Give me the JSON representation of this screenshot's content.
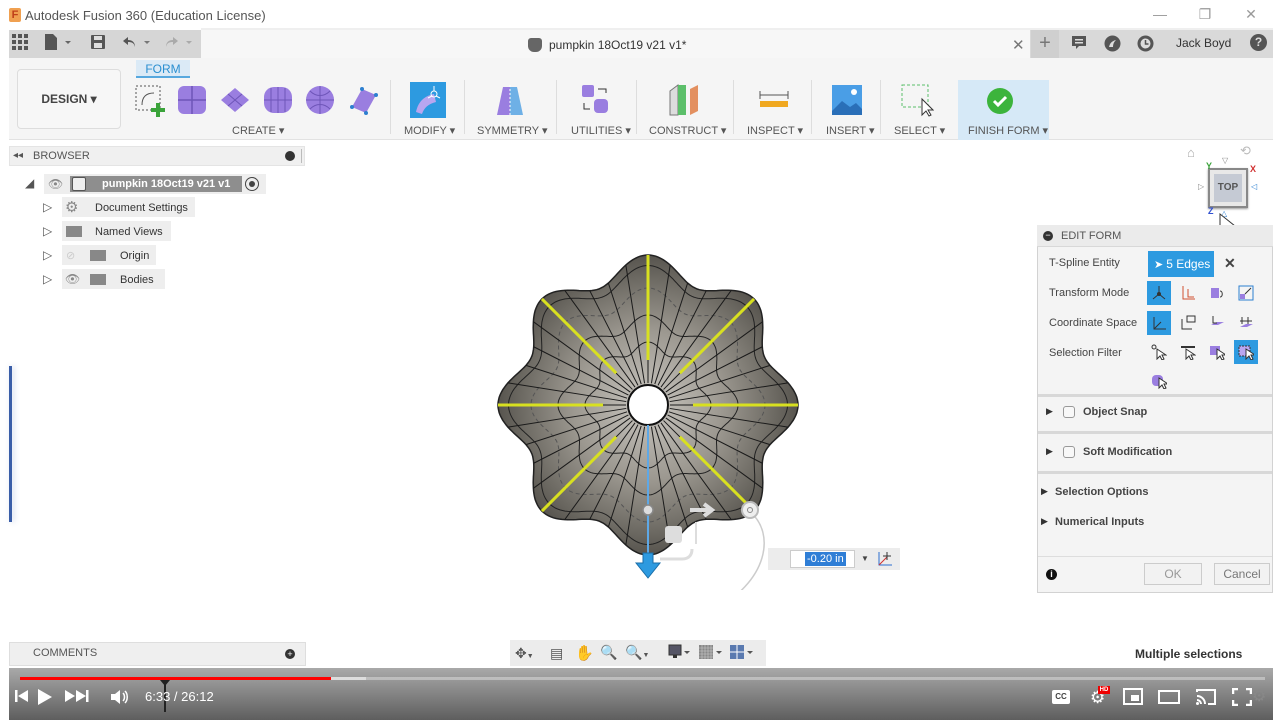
{
  "window": {
    "title": "Autodesk Fusion 360 (Education License)",
    "logo": "F",
    "controls": {
      "minimize": "—",
      "restore": "❐",
      "close": "✕"
    }
  },
  "qat": {
    "icons": [
      "apps-grid-icon",
      "file-icon",
      "save-icon",
      "undo-icon",
      "redo-icon"
    ]
  },
  "document": {
    "tab_title": "pumpkin 18Oct19 v21 v1*",
    "close": "✕",
    "new_tab": "+",
    "user": "Jack Boyd",
    "help": "?"
  },
  "ribbon": {
    "workspace": "DESIGN ▾",
    "active_tab": "FORM",
    "groups": [
      {
        "label": "CREATE ▾"
      },
      {
        "label": "MODIFY ▾"
      },
      {
        "label": "SYMMETRY ▾"
      },
      {
        "label": "UTILITIES ▾"
      },
      {
        "label": "CONSTRUCT ▾"
      },
      {
        "label": "INSPECT ▾"
      },
      {
        "label": "INSERT ▾"
      },
      {
        "label": "SELECT ▾"
      },
      {
        "label": "FINISH FORM ▾"
      }
    ]
  },
  "browser": {
    "title": "BROWSER",
    "root": "pumpkin 18Oct19 v21 v1",
    "items": [
      {
        "label": "Document Settings",
        "icon": "gear-icon"
      },
      {
        "label": "Named Views",
        "icon": "folder-icon"
      },
      {
        "label": "Origin",
        "icon": "folder-icon",
        "hidden": true
      },
      {
        "label": "Bodies",
        "icon": "folder-icon"
      }
    ]
  },
  "viewcube": {
    "face": "TOP",
    "axes": [
      "X",
      "Y",
      "Z"
    ]
  },
  "manipulator": {
    "value": "-0.20 in"
  },
  "edit_form": {
    "title": "EDIT FORM",
    "tspline_label": "T-Spline Entity",
    "tspline_value": "5 Edges",
    "transform_label": "Transform Mode",
    "coord_label": "Coordinate Space",
    "filter_label": "Selection Filter",
    "object_snap": "Object Snap",
    "soft_mod": "Soft Modification",
    "selection_options": "Selection Options",
    "numerical_inputs": "Numerical Inputs",
    "ok": "OK",
    "cancel": "Cancel"
  },
  "comments": {
    "title": "COMMENTS"
  },
  "status": {
    "text": "Multiple selections"
  },
  "video": {
    "current": "6:33",
    "duration": "26:12",
    "time_display": "6:33 / 26:12",
    "played_fraction": 0.25,
    "buffered_fraction": 0.278,
    "progress_color": "#ff0000"
  }
}
